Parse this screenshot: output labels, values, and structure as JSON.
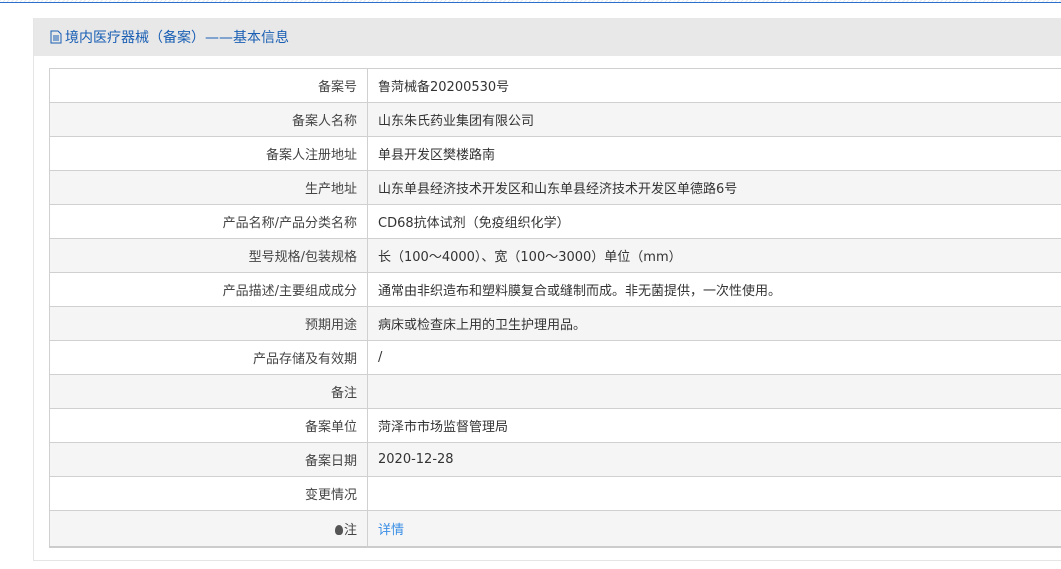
{
  "header": {
    "title": "境内医疗器械（备案）——基本信息"
  },
  "rows": [
    {
      "label": "备案号",
      "value": "鲁菏械备20200530号"
    },
    {
      "label": "备案人名称",
      "value": "山东朱氏药业集团有限公司"
    },
    {
      "label": "备案人注册地址",
      "value": "单县开发区樊楼路南"
    },
    {
      "label": "生产地址",
      "value": "山东单县经济技术开发区和山东单县经济技术开发区单德路6号"
    },
    {
      "label": "产品名称/产品分类名称",
      "value": "CD68抗体试剂（免疫组织化学）"
    },
    {
      "label": "型号规格/包装规格",
      "value": "长（100～4000）、宽（100～3000）单位（mm）"
    },
    {
      "label": "产品描述/主要组成成分",
      "value": "通常由非织造布和塑料膜复合或缝制而成。非无菌提供，一次性使用。"
    },
    {
      "label": "预期用途",
      "value": "病床或检查床上用的卫生护理用品。"
    },
    {
      "label": "产品存储及有效期",
      "value": "/"
    },
    {
      "label": "备注",
      "value": ""
    },
    {
      "label": "备案单位",
      "value": "菏泽市市场监督管理局"
    },
    {
      "label": "备案日期",
      "value": "2020-12-28"
    },
    {
      "label": "变更情况",
      "value": ""
    }
  ],
  "note": {
    "label": "注",
    "link": "详情"
  }
}
